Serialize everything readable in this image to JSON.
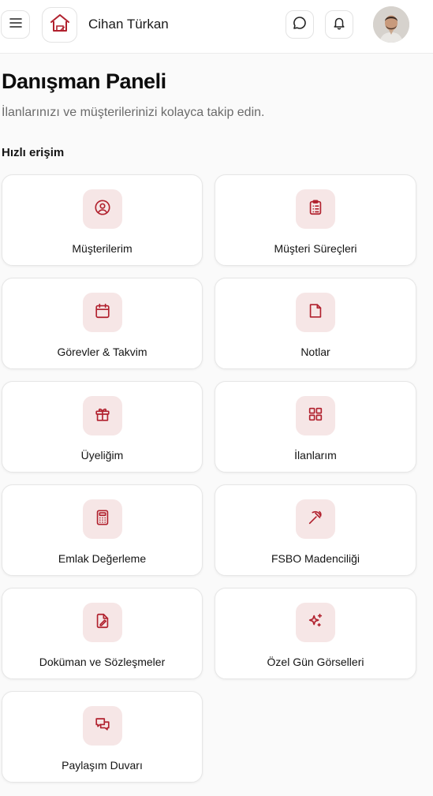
{
  "colors": {
    "accent": "#b1212e",
    "icon_tile_bg": "#f6e6e6",
    "background": "#fafafa"
  },
  "header": {
    "menu_icon": "hamburger-icon",
    "logo_icon": "house-logo-icon",
    "user_name": "Cihan Türkan",
    "chat_icon": "chat-bubble-icon",
    "notification_icon": "bell-icon",
    "avatar": "user-avatar-photo"
  },
  "page": {
    "title": "Danışman Paneli",
    "subtitle": "İlanlarınızı ve müşterilerinizi kolayca takip edin."
  },
  "quick_access": {
    "title": "Hızlı erişim",
    "items": [
      {
        "label": "Müşterilerim",
        "icon": "user-circle-icon"
      },
      {
        "label": "Müşteri Süreçleri",
        "icon": "clipboard-list-icon"
      },
      {
        "label": "Görevler & Takvim",
        "icon": "calendar-icon"
      },
      {
        "label": "Notlar",
        "icon": "note-icon"
      },
      {
        "label": "Üyeliğim",
        "icon": "gift-icon"
      },
      {
        "label": "İlanlarım",
        "icon": "grid-icon"
      },
      {
        "label": "Emlak Değerleme",
        "icon": "calculator-icon"
      },
      {
        "label": "FSBO Madenciliği",
        "icon": "pickaxe-icon"
      },
      {
        "label": "Doküman ve Sözleşmeler",
        "icon": "file-signature-icon"
      },
      {
        "label": "Özel Gün Görselleri",
        "icon": "sparkles-icon"
      },
      {
        "label": "Paylaşım Duvarı",
        "icon": "messages-icon"
      }
    ]
  }
}
